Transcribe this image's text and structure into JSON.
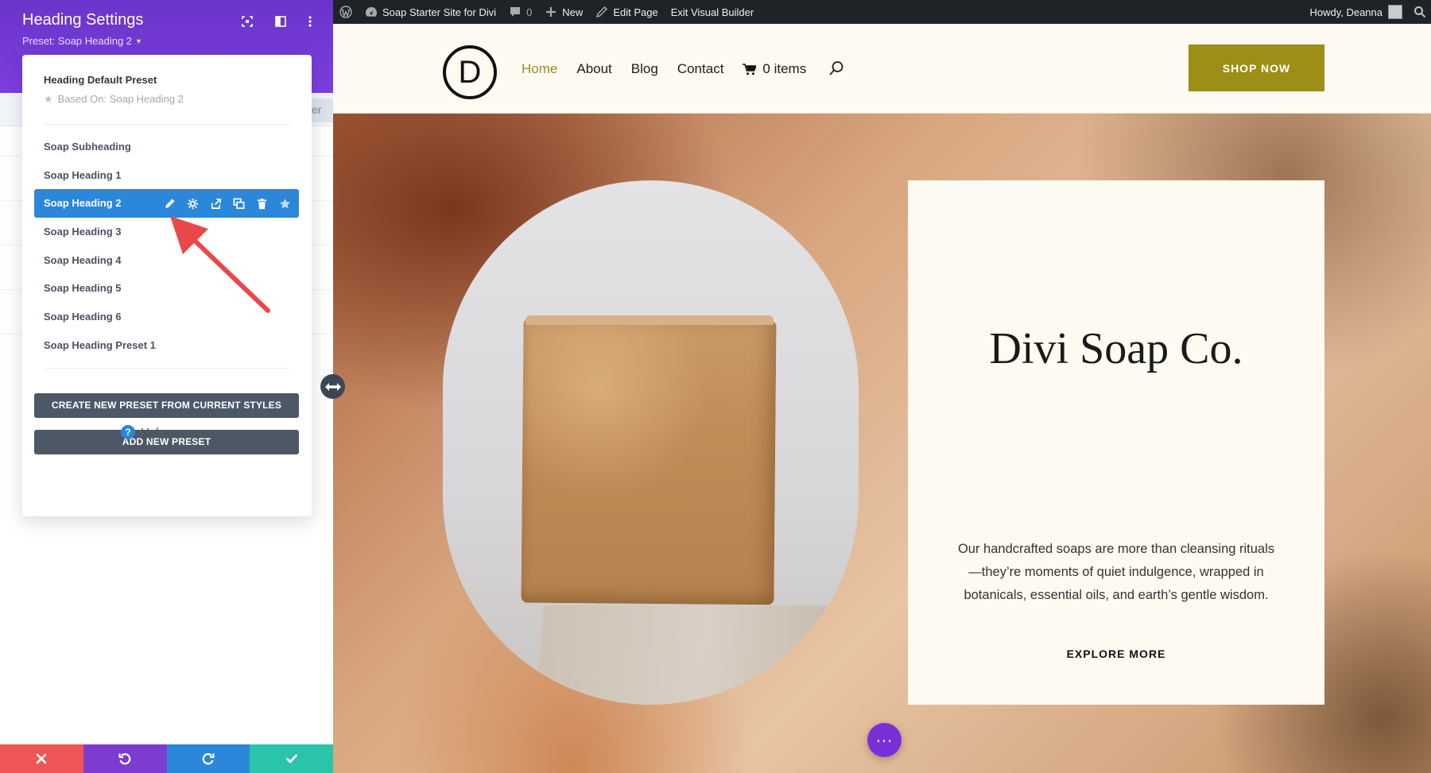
{
  "settings_panel": {
    "title": "Heading Settings",
    "preset_label": "Preset: Soap Heading 2",
    "header_icons": [
      "focus-icon",
      "split-view-icon",
      "more-vertical-icon"
    ],
    "bg_search_text": "er",
    "dropdown": {
      "default_preset": {
        "title": "Heading Default Preset",
        "based_on": "Based On: Soap Heading 2"
      },
      "presets": [
        {
          "label": "Soap Subheading",
          "active": false
        },
        {
          "label": "Soap Heading 1",
          "active": false
        },
        {
          "label": "Soap Heading 2",
          "active": true
        },
        {
          "label": "Soap Heading 3",
          "active": false
        },
        {
          "label": "Soap Heading 4",
          "active": false
        },
        {
          "label": "Soap Heading 5",
          "active": false
        },
        {
          "label": "Soap Heading 6",
          "active": false
        },
        {
          "label": "Soap Heading Preset 1",
          "active": false
        }
      ],
      "active_actions": [
        "edit-icon",
        "settings-icon",
        "export-icon",
        "duplicate-icon",
        "delete-icon",
        "star-icon"
      ],
      "create_from_current_label": "CREATE NEW PRESET FROM CURRENT STYLES",
      "add_new_label": "ADD NEW PRESET",
      "help_label": "Help"
    },
    "bottom_bar": {
      "buttons": [
        {
          "name": "discard-button",
          "icon": "close-icon",
          "color": "#ef5555"
        },
        {
          "name": "undo-button",
          "icon": "undo-icon",
          "color": "#7e3bd0"
        },
        {
          "name": "redo-button",
          "icon": "redo-icon",
          "color": "#2b87da"
        },
        {
          "name": "save-button",
          "icon": "check-icon",
          "color": "#29c4a9"
        }
      ]
    }
  },
  "admin_bar": {
    "site_name": "Soap Starter Site for Divi",
    "comments_count": "0",
    "new_label": "New",
    "edit_page_label": "Edit Page",
    "exit_builder_label": "Exit Visual Builder",
    "greeting": "Howdy, Deanna"
  },
  "site_header": {
    "logo_letter": "D",
    "nav": [
      "Home",
      "About",
      "Blog",
      "Contact"
    ],
    "cart_label": "0 items",
    "shop_now_label": "SHOP NOW",
    "accent_color": "#9c8e17"
  },
  "hero": {
    "title": "Divi Soap Co.",
    "body": "Our handcrafted soaps are more than cleansing rituals—they’re moments of quiet indulgence, wrapped in botanicals, essential oils, and earth’s gentle wisdom.",
    "cta_label": "EXPLORE MORE"
  },
  "colors": {
    "panel_purple": "#7b3fe0",
    "active_blue": "#2b87da",
    "dark_button": "#4c5866",
    "annotation_red": "#e8484a"
  }
}
